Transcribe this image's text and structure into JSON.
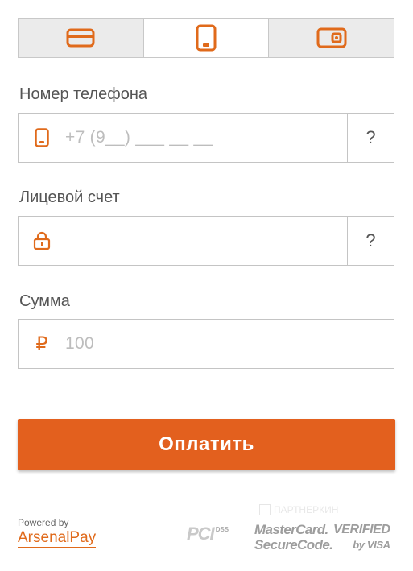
{
  "tabs": [
    {
      "icon": "credit-card-icon",
      "active": false
    },
    {
      "icon": "phone-icon",
      "active": true
    },
    {
      "icon": "wallet-icon",
      "active": false
    }
  ],
  "phone": {
    "label": "Номер телефона",
    "placeholder": "+7 (9__) ___ __ __",
    "help": "?"
  },
  "account": {
    "label": "Лицевой счет",
    "value": "",
    "help": "?"
  },
  "amount": {
    "label": "Сумма",
    "currency_symbol": "₽",
    "placeholder": "100"
  },
  "pay_button": {
    "label": "Оплатить"
  },
  "footer": {
    "powered_by": "Powered by",
    "brand": "ArsenalPay",
    "pci": "PCI",
    "dss": "DSS",
    "mastercard_line1": "MasterCard.",
    "mastercard_line2": "SecureCode.",
    "visa_line1": "VERIFIED",
    "visa_line2": "by VISA",
    "watermark": "ПАРТНЕРКИН"
  },
  "colors": {
    "accent": "#e3601e",
    "border": "#c4c4c4",
    "placeholder": "#bdbdbd"
  }
}
